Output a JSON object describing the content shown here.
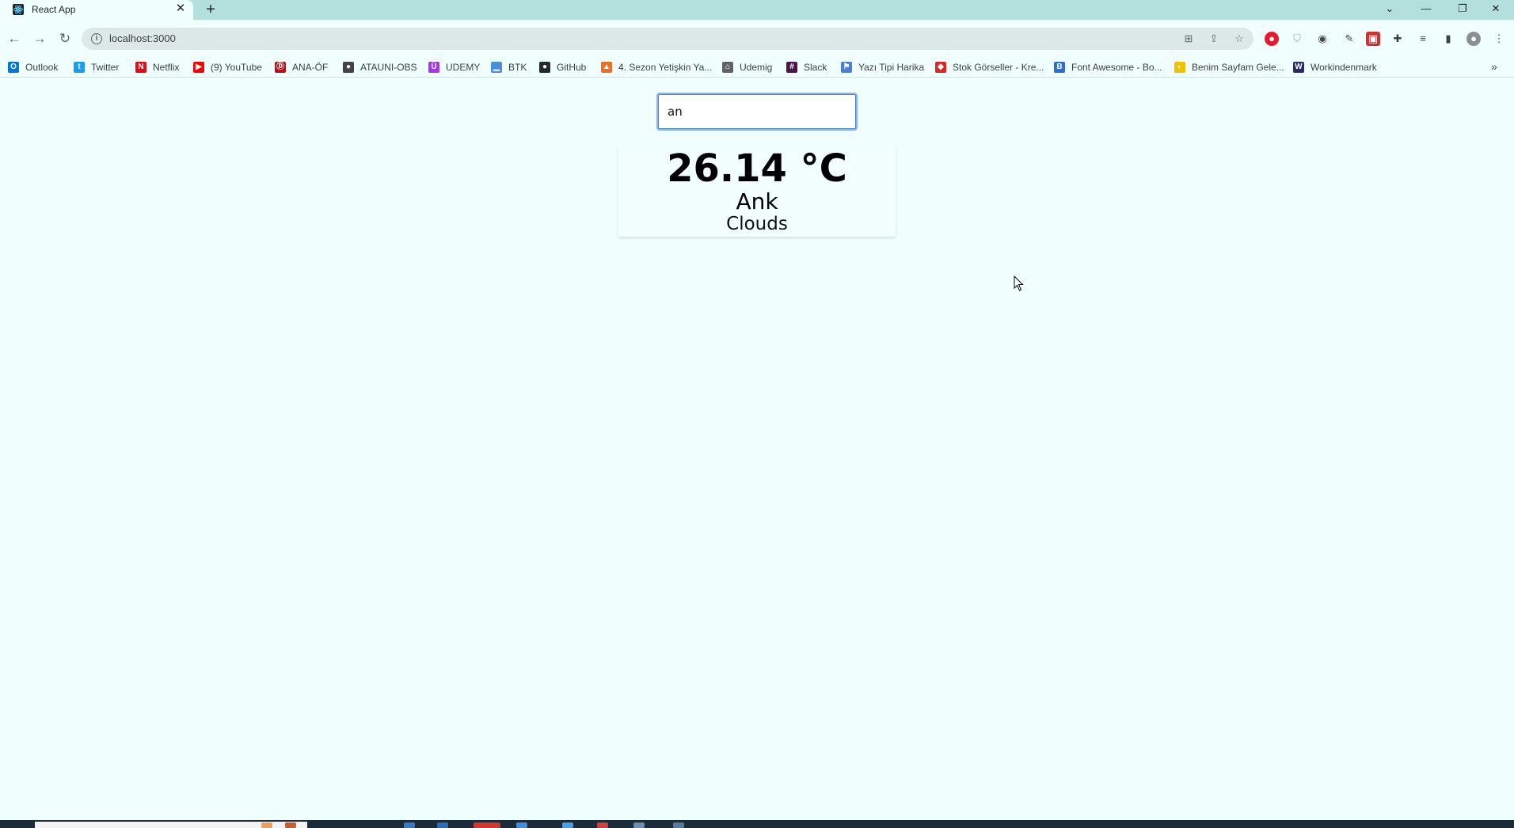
{
  "browser": {
    "tab": {
      "title": "React App"
    },
    "address_bar": {
      "url": "localhost:3000"
    },
    "bookmarks": [
      {
        "label": "Outlook",
        "icon": "outlook-icon",
        "color": "#0078d4"
      },
      {
        "label": "Twitter",
        "icon": "twitter-icon",
        "color": "#1d9bf0"
      },
      {
        "label": "Netflix",
        "icon": "netflix-icon",
        "color": "#e50914"
      },
      {
        "label": "(9) YouTube",
        "icon": "youtube-icon",
        "color": "#ff0000"
      },
      {
        "label": "ANA-ÖF",
        "icon": "anaof-icon",
        "color": "#b3121d"
      },
      {
        "label": "ATAUNI-OBS",
        "icon": "atauni-icon",
        "color": "#444444"
      },
      {
        "label": "UDEMY",
        "icon": "udemy-icon",
        "color": "#a435f0"
      },
      {
        "label": "BTK",
        "icon": "btk-icon",
        "color": "#4a90d9"
      },
      {
        "label": "GitHub",
        "icon": "github-icon",
        "color": "#24292f"
      },
      {
        "label": "4. Sezon Yetişkin Ya...",
        "icon": "sezon-icon",
        "color": "#e8702a"
      },
      {
        "label": "Udemig",
        "icon": "udemig-icon",
        "color": "#5f6368"
      },
      {
        "label": "Slack",
        "icon": "slack-icon",
        "color": "#4a154b"
      },
      {
        "label": "Yazı Tipi Harika",
        "icon": "flag-icon",
        "color": "#4a7fd4"
      },
      {
        "label": "Stok Görseller - Kre...",
        "icon": "stok-icon",
        "color": "#e02424"
      },
      {
        "label": "Font Awesome - Bo...",
        "icon": "bootstrap-icon",
        "color": "#2b6fd6"
      },
      {
        "label": "Benim Sayfam Gele...",
        "icon": "benim-icon",
        "color": "#f2c200"
      },
      {
        "label": "Workindenmark",
        "icon": "workindenmark-icon",
        "color": "#2b2b6a"
      }
    ]
  },
  "app": {
    "search": {
      "value": "an"
    },
    "weather": {
      "temperature": "26.14 °C",
      "city": "Ank",
      "condition": "Clouds"
    }
  },
  "colors": {
    "page_background": "#f0fffe",
    "tab_strip": "#b3dfdd",
    "input_focus": "#8ab4f8"
  }
}
